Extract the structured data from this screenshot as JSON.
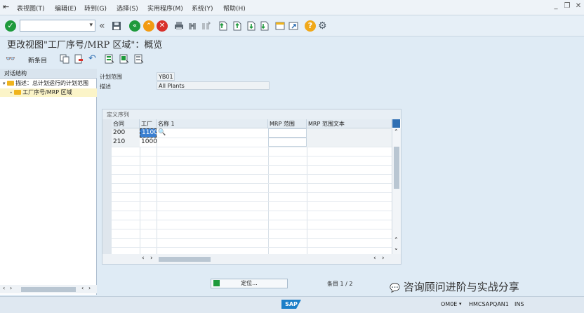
{
  "menu": {
    "items": [
      "表视图(T)",
      "编辑(E)",
      "转到(G)",
      "选择(S)",
      "实用程序(M)",
      "系统(Y)",
      "帮助(H)"
    ]
  },
  "window_controls": [
    "minimize",
    "restore",
    "close"
  ],
  "toolbar": {
    "command_field_value": "",
    "icons": [
      "check-icon",
      "back-double-icon",
      "save-icon",
      "back-icon",
      "exit-icon",
      "cancel-icon",
      "print-icon",
      "find-icon",
      "find-next-icon",
      "first-page-icon",
      "prev-page-icon",
      "next-page-icon",
      "last-page-icon",
      "new-session-icon",
      "shortcut-icon",
      "help-icon",
      "settings-icon"
    ]
  },
  "page_title": "更改视图\"工厂序号/MRP 区域\"：概览",
  "app_toolbar": {
    "new_entries_label": "新条目",
    "icons": [
      "glasses-icon",
      "copy-icon",
      "delete-icon",
      "undo-icon",
      "select-all-icon",
      "select-block-icon",
      "deselect-all-icon"
    ]
  },
  "dialog_structure": {
    "header": "对话结构",
    "items": [
      {
        "label": "描述：总计划运行的计划范围",
        "level": 0
      },
      {
        "label": "工厂序号/MRP 区域",
        "level": 1,
        "selected": true
      }
    ]
  },
  "header_fields": {
    "plan_scope_label": "计划范围",
    "plan_scope_value": "YB01",
    "description_label": "描述",
    "description_value": "All Plants"
  },
  "table": {
    "group_title": "定义序列",
    "columns": [
      "合同",
      "工厂",
      "名称 1",
      "MRP 范围",
      "MRP 范围文本"
    ],
    "rows": [
      {
        "seq": "200",
        "plant": "1100",
        "name": "",
        "mrp_area": "",
        "mrp_text": ""
      },
      {
        "seq": "210",
        "plant": "1000",
        "name": "",
        "mrp_area": "",
        "mrp_text": ""
      }
    ]
  },
  "position_button_label": "定位...",
  "entry_counter": "条目 1 / 2",
  "watermark": "咨询顾问进阶与实战分享",
  "status_bar": {
    "logo": "SAP",
    "transaction": "OM0E",
    "server": "HMCSAPQAN1",
    "mode": "INS"
  },
  "colors": {
    "accent_green": "#1e9a3c",
    "accent_orange": "#f29b12",
    "accent_red": "#d8312b",
    "selection_blue": "#3b7fd0",
    "background": "#dfebf5"
  }
}
